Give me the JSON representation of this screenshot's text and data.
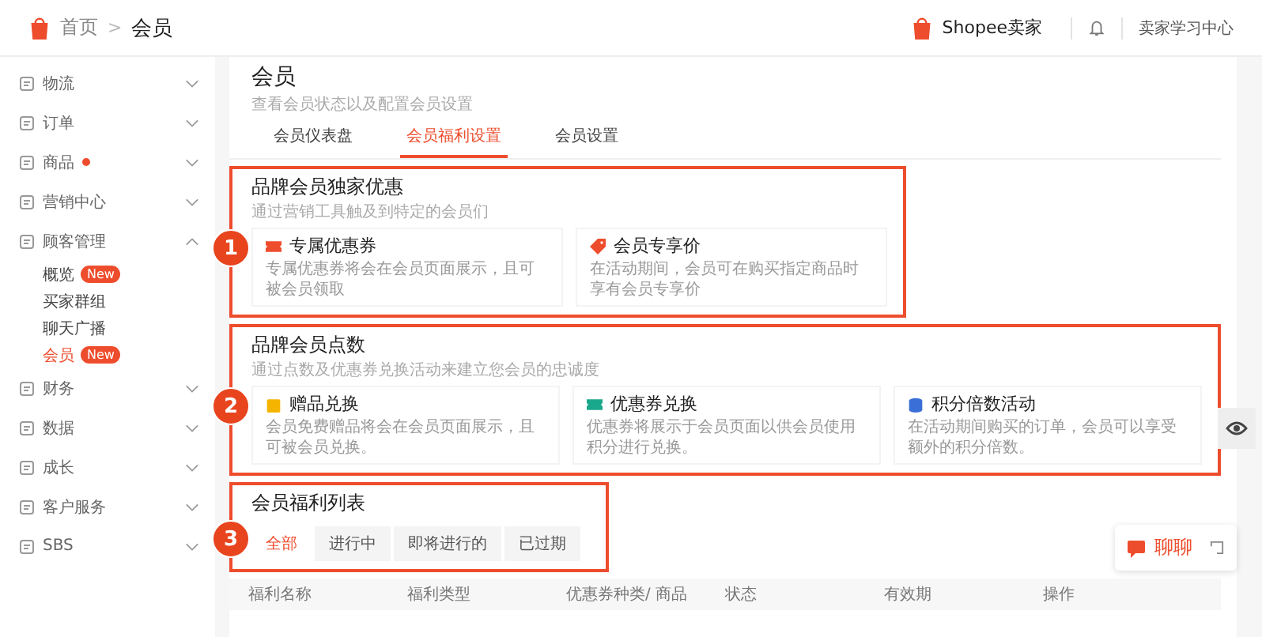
{
  "header": {
    "breadcrumb": [
      "首页",
      "会员"
    ],
    "separator": ">",
    "brand": "Shopee卖家",
    "learning_center": "卖家学习中心"
  },
  "sidebar": {
    "items": [
      {
        "label": "物流",
        "expanded": false,
        "dot": false
      },
      {
        "label": "订单",
        "expanded": false,
        "dot": false
      },
      {
        "label": "商品",
        "expanded": false,
        "dot": true
      },
      {
        "label": "营销中心",
        "expanded": false,
        "dot": false
      },
      {
        "label": "顾客管理",
        "expanded": true,
        "dot": false,
        "children": [
          {
            "label": "概览",
            "badge": "New",
            "selected": false
          },
          {
            "label": "买家群组",
            "selected": false
          },
          {
            "label": "聊天广播",
            "selected": false
          },
          {
            "label": "会员",
            "badge": "New",
            "selected": true
          }
        ]
      },
      {
        "label": "财务",
        "expanded": false,
        "dot": false
      },
      {
        "label": "数据",
        "expanded": false,
        "dot": false
      },
      {
        "label": "成长",
        "expanded": false,
        "dot": false
      },
      {
        "label": "客户服务",
        "expanded": false,
        "dot": false
      },
      {
        "label": "SBS",
        "expanded": false,
        "dot": false
      }
    ]
  },
  "page": {
    "title": "会员",
    "subtitle": "查看会员状态以及配置会员设置",
    "tabs": [
      {
        "label": "会员仪表盘",
        "selected": false
      },
      {
        "label": "会员福利设置",
        "selected": true
      },
      {
        "label": "会员设置",
        "selected": false
      }
    ]
  },
  "sections": [
    {
      "kind": "cards",
      "number": "1",
      "title": "品牌会员独家优惠",
      "subtitle": "通过营销工具触及到特定的会员们",
      "cards": [
        {
          "kind": "coupon",
          "title": "专属优惠券",
          "description": "专属优惠券将会在会员页面展示，且可被会员领取"
        },
        {
          "kind": "tag",
          "title": "会员专享价",
          "description": "在活动期间，会员可在购买指定商品时享有会员专享价"
        }
      ]
    },
    {
      "kind": "cards",
      "number": "2",
      "title": "品牌会员点数",
      "subtitle": "通过点数及优惠券兑换活动来建立您会员的忠诚度",
      "cards": [
        {
          "kind": "gift",
          "title": "赠品兑换",
          "description": "会员免费赠品将会在会员页面展示，且可被会员兑换。"
        },
        {
          "kind": "ticket",
          "title": "优惠券兑换",
          "description": "优惠券将展示于会员页面以供会员使用积分进行兑换。"
        },
        {
          "kind": "coins",
          "title": "积分倍数活动",
          "description": "在活动期间购买的订单，会员可以享受额外的积分倍数。"
        }
      ]
    },
    {
      "kind": "list",
      "number": "3",
      "title": "会员福利列表",
      "tabs": [
        {
          "label": "全部",
          "selected": true
        },
        {
          "label": "进行中",
          "selected": false
        },
        {
          "label": "即将进行的",
          "selected": false
        },
        {
          "label": "已过期",
          "selected": false
        }
      ]
    }
  ],
  "table": {
    "columns": [
      "福利名称",
      "福利类型",
      "优惠券种类/ 商品",
      "状态",
      "有效期",
      "操作"
    ]
  },
  "chat": {
    "label": "聊聊"
  }
}
